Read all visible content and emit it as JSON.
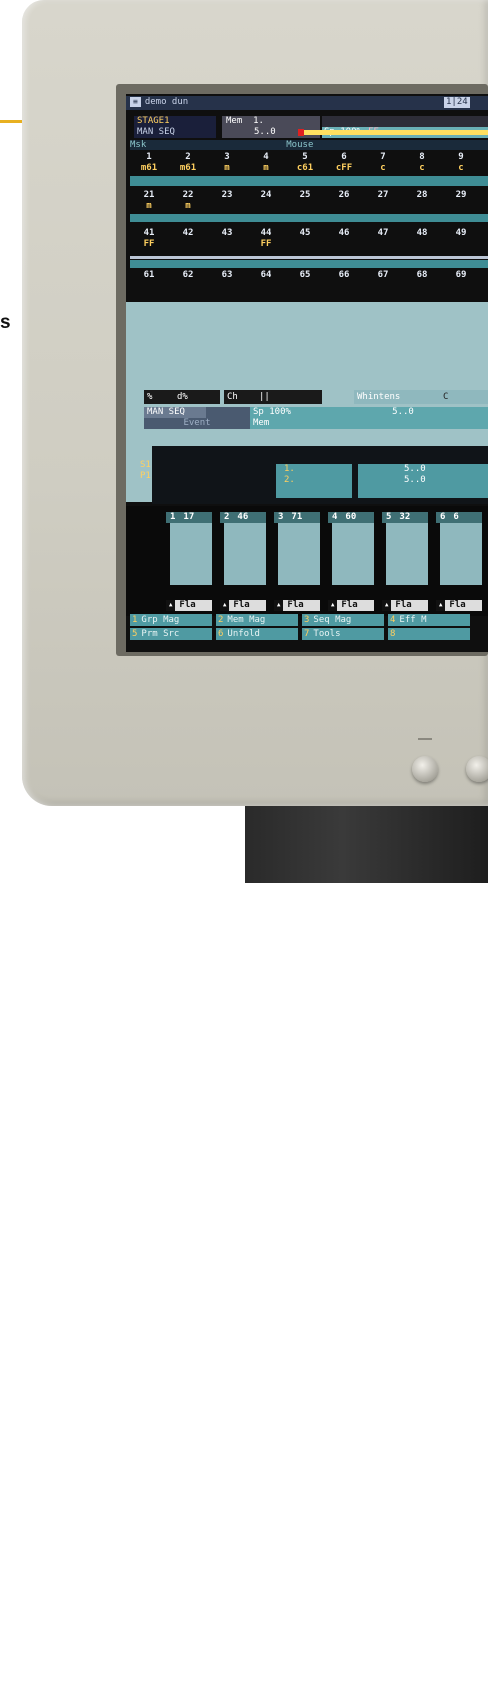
{
  "page": {
    "side_text": "s"
  },
  "screen": {
    "title": "demo dun",
    "clock": "1|24",
    "stage": {
      "line1": "STAGE1",
      "line2": "MAN SEQ"
    },
    "memory": {
      "label": "Mem",
      "number": "1.",
      "value": "5..0"
    },
    "speed": {
      "label": "Sp 100%",
      "ff": "FF"
    },
    "labels": {
      "left": "Msk",
      "mid": "Mouse"
    },
    "channels_row1": [
      {
        "n": "1",
        "v": "m61"
      },
      {
        "n": "2",
        "v": "m61"
      },
      {
        "n": "3",
        "v": "m"
      },
      {
        "n": "4",
        "v": "m"
      },
      {
        "n": "5",
        "v": "c61"
      },
      {
        "n": "6",
        "v": "cFF"
      },
      {
        "n": "7",
        "v": "c"
      },
      {
        "n": "8",
        "v": "c"
      },
      {
        "n": "9",
        "v": "c"
      }
    ],
    "channels_row2": [
      {
        "n": "21",
        "v": "m"
      },
      {
        "n": "22",
        "v": "m"
      },
      {
        "n": "23",
        "v": ""
      },
      {
        "n": "24",
        "v": ""
      },
      {
        "n": "25",
        "v": ""
      },
      {
        "n": "26",
        "v": ""
      },
      {
        "n": "27",
        "v": ""
      },
      {
        "n": "28",
        "v": ""
      },
      {
        "n": "29",
        "v": ""
      }
    ],
    "channels_row3": [
      {
        "n": "41",
        "v": "FF"
      },
      {
        "n": "42",
        "v": ""
      },
      {
        "n": "43",
        "v": ""
      },
      {
        "n": "44",
        "v": "FF"
      },
      {
        "n": "45",
        "v": ""
      },
      {
        "n": "46",
        "v": ""
      },
      {
        "n": "47",
        "v": ""
      },
      {
        "n": "48",
        "v": ""
      },
      {
        "n": "49",
        "v": ""
      }
    ],
    "channels_row4": [
      {
        "n": "61",
        "v": ""
      },
      {
        "n": "62",
        "v": ""
      },
      {
        "n": "63",
        "v": ""
      },
      {
        "n": "64",
        "v": ""
      },
      {
        "n": "65",
        "v": ""
      },
      {
        "n": "66",
        "v": ""
      },
      {
        "n": "67",
        "v": ""
      },
      {
        "n": "68",
        "v": ""
      },
      {
        "n": "69",
        "v": ""
      }
    ],
    "controls": {
      "pct": "%",
      "dpct": "d%",
      "ch": "Ch",
      "sep": "||",
      "intens": "Whintens",
      "extra": "C"
    },
    "seq": {
      "name": "MAN SEQ",
      "speed": "Sp 100%",
      "val": "5..0",
      "event": "Event",
      "mem": "Mem"
    },
    "list": {
      "s1": "S1",
      "p1": "P1",
      "items": [
        "1.",
        "2."
      ],
      "values": [
        "5..0",
        "5..0"
      ]
    },
    "faders": [
      {
        "n": "1",
        "v": "17",
        "lbl": "Fla"
      },
      {
        "n": "2",
        "v": "46",
        "lbl": "Fla"
      },
      {
        "n": "3",
        "v": "71",
        "lbl": "Fla"
      },
      {
        "n": "4",
        "v": "60",
        "lbl": "Fla"
      },
      {
        "n": "5",
        "v": "32",
        "lbl": "Fla"
      },
      {
        "n": "6",
        "v": "6",
        "lbl": "Fla"
      }
    ],
    "softkeys": [
      {
        "k": "1",
        "t": "Grp Mag"
      },
      {
        "k": "2",
        "t": "Mem Mag"
      },
      {
        "k": "3",
        "t": "Seq Mag"
      },
      {
        "k": "4",
        "t": "Eff M"
      },
      {
        "k": "5",
        "t": "Prm Src"
      },
      {
        "k": "6",
        "t": "Unfold"
      },
      {
        "k": "7",
        "t": "Tools"
      },
      {
        "k": "8",
        "t": ""
      }
    ]
  }
}
